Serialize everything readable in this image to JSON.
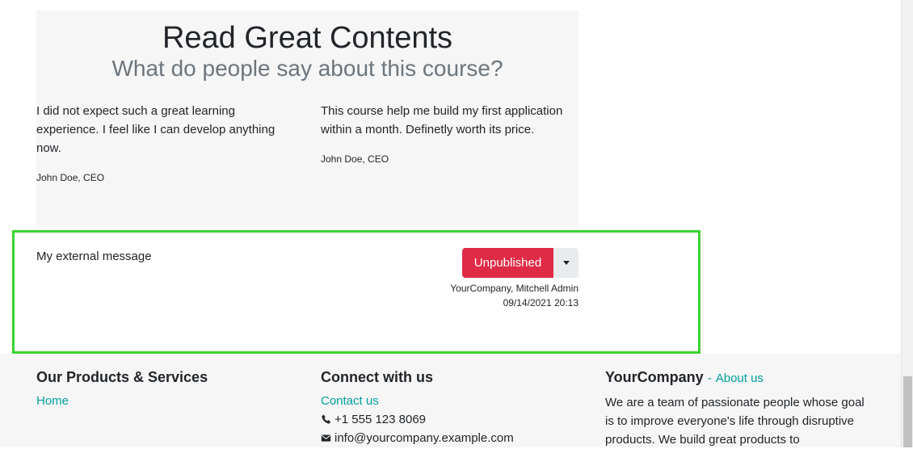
{
  "testimonials": {
    "title": "Read Great Contents",
    "subtitle": "What do people say about this course?",
    "quotes": [
      {
        "text": "I did not expect such a great learning experience. I feel like I can develop anything now.",
        "author": "John Doe, CEO"
      },
      {
        "text": "This course help me build my first application within a month. Definetly worth its price.",
        "author": "John Doe, CEO"
      }
    ]
  },
  "message": {
    "text": "My external message",
    "status_button": "Unpublished",
    "author": "YourCompany, Mitchell Admin",
    "datetime": "09/14/2021 20:13"
  },
  "footer": {
    "products": {
      "heading": "Our Products & Services",
      "links": [
        "Home"
      ]
    },
    "connect": {
      "heading": "Connect with us",
      "contact_link": "Contact us",
      "phone": "+1 555 123 8069",
      "email": "info@yourcompany.example.com"
    },
    "company": {
      "heading": "YourCompany",
      "separator": "-",
      "about_link": "About us",
      "description": "We are a team of passionate people whose goal is to improve everyone's life through disruptive products. We build great products to"
    }
  },
  "icons": {
    "phone": "phone-icon",
    "email": "envelope-icon",
    "dropdown": "caret-down-icon"
  },
  "colors": {
    "accent": "#00a09d",
    "danger": "#e02b46",
    "highlight": "#3ad32e"
  }
}
